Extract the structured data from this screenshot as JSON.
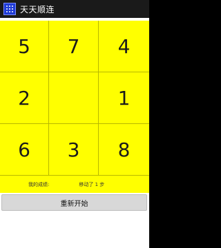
{
  "app": {
    "title": "天天顺连",
    "icon": "grid-dots-icon"
  },
  "board": {
    "background": "#ffff00",
    "cells": [
      "5",
      "7",
      "4",
      "2",
      "",
      "1",
      "6",
      "3",
      "8"
    ]
  },
  "status": {
    "best_label": "我的成绩:",
    "moves_label": "移动了 1 步"
  },
  "actions": {
    "restart_label": "重新开始"
  }
}
